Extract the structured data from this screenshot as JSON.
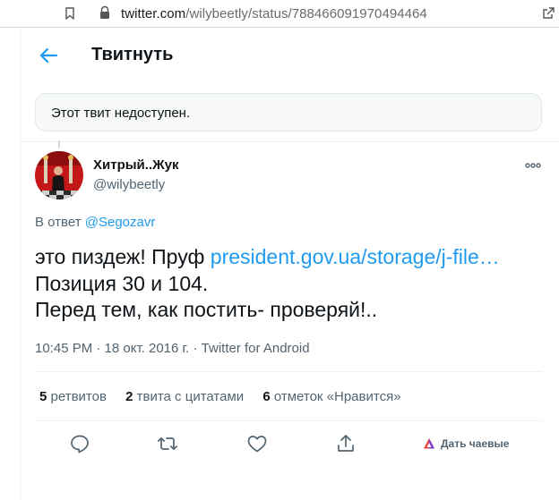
{
  "browser": {
    "url_host": "twitter.com",
    "url_path": "/wilybeetly/status/788466091970494464"
  },
  "header": {
    "title": "Твитнуть"
  },
  "unavailable_notice": "Этот твит недоступен.",
  "tweet": {
    "author_name": "Хитрый..Жук",
    "author_handle": "@wilybeetly",
    "reply_prefix": "В ответ",
    "reply_mention": "@Segozavr",
    "text_line1_prefix": "это пиздеж! Пруф",
    "text_line1_link": "president.gov.ua/storage/j-file…",
    "text_line2": "Позиция 30 и 104.",
    "text_line3": "Перед тем, как постить- проверяй!..",
    "meta": "10:45 PM · 18 окт. 2016 г. · Twitter for Android"
  },
  "stats": {
    "retweets_count": "5",
    "retweets_label": "ретвитов",
    "quotes_count": "2",
    "quotes_label": "твита с цитатами",
    "likes_count": "6",
    "likes_label": "отметок «Нравится»"
  },
  "actions": {
    "reply_icon": "reply-icon",
    "retweet_icon": "retweet-icon",
    "like_icon": "heart-icon",
    "share_icon": "share-icon",
    "tip_label": "Дать чаевые"
  },
  "colors": {
    "accent": "#1d9bf0",
    "text": "#0f1419",
    "muted": "#536471"
  }
}
